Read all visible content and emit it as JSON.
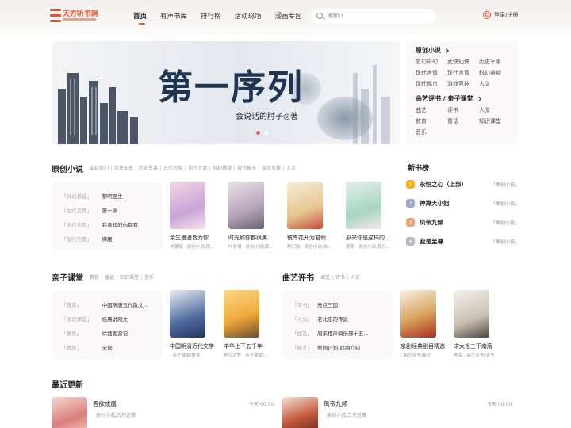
{
  "header": {
    "logo_text": "天方听书网",
    "nav": [
      "首页",
      "有声书库",
      "排行榜",
      "活动现场",
      "漫画专区"
    ],
    "search_placeholder": "搜索们",
    "login": "登录/注册"
  },
  "banner": {
    "title": "第一序列",
    "author": "会说话的肘子◎著"
  },
  "side_categories": [
    {
      "title": "原创小说",
      "items": [
        "玄幻奇幻",
        "武侠仙侠",
        "历史军事",
        "现代言情",
        "现代言情",
        "科幻悬疑",
        "现代都市",
        "游戏竞技",
        "人文"
      ]
    },
    {
      "title": "曲艺评书 / 亲子课堂",
      "items": [
        "曲艺",
        "评书",
        "人文",
        "教育",
        "童话",
        "知识课堂",
        "音乐"
      ]
    }
  ],
  "original": {
    "title": "原创小说",
    "tags": [
      "玄幻奇幻",
      "武侠仙侠",
      "历史军事",
      "古代言情",
      "现代言情",
      "科幻悬疑",
      "现代都市",
      "游戏竞技",
      "人文"
    ],
    "list": [
      {
        "tag": "「科幻悬疑」",
        "name": "黎明医生"
      },
      {
        "tag": "「古代言情」",
        "name": "第一侯"
      },
      {
        "tag": "「现代言情」",
        "name": "我喜欢的你都有"
      },
      {
        "tag": "「现代言情」",
        "name": "撑腰"
      }
    ],
    "books": [
      {
        "name": "余生漫漫皆为你",
        "meta": "洋蓬鹄 · 原创小说/现..."
      },
      {
        "name": "时光和你都很美",
        "meta": "叶非凝 · 原创小说/现..."
      },
      {
        "name": "彼岸花开为君倾",
        "meta": "穆闩筱 · 原创小说/古..."
      },
      {
        "name": "原来你是这样的...",
        "meta": "黛菁 · 原创小说/现代..."
      }
    ]
  },
  "new_rank": {
    "title": "新书榜",
    "items": [
      {
        "rank": "1",
        "name": "永恒之心（上部）",
        "cat": "「原创小说」"
      },
      {
        "rank": "2",
        "name": "神算大小姐",
        "cat": "「原创小说」"
      },
      {
        "rank": "3",
        "name": "凤帝九倾",
        "cat": "「原创小说」"
      },
      {
        "rank": "4",
        "name": "我是至尊",
        "cat": "「原创小说」"
      }
    ]
  },
  "parent": {
    "title": "亲子课堂",
    "tags": [
      "教育",
      "童话",
      "知识课堂",
      "音乐"
    ],
    "list": [
      {
        "tag": "「教育」",
        "name": "中国隋唐五代散文..."
      },
      {
        "tag": "「知识课堂」",
        "name": "杨晨说网文"
      },
      {
        "tag": "「教育」",
        "name": "徐茜客游记"
      },
      {
        "tag": "「教育」",
        "name": "宋词"
      }
    ],
    "books": [
      {
        "name": "中国明清近代文学",
        "meta": "· 亲子课堂/教育"
      },
      {
        "name": "中华上下五千年",
        "meta": "林汉达等 · 亲子课堂/..."
      }
    ]
  },
  "quyi": {
    "title": "曲艺评书",
    "tags": [
      "曲艺",
      "评书",
      "人文"
    ],
    "list": [
      {
        "tag": "「评书」",
        "name": "亮点三国"
      },
      {
        "tag": "「人文」",
        "name": "老北京的传说"
      },
      {
        "tag": "「曲艺」",
        "name": "周末相声俱乐部十五..."
      },
      {
        "tag": "「曲艺」",
        "name": "梨园计划-戏曲介绍"
      }
    ],
    "books": [
      {
        "name": "京剧经典剧目精选",
        "meta": "· 曲艺评书/曲艺"
      },
      {
        "name": "宋太祖三下南唐",
        "meta": "佚名 · 曲艺评书/评书"
      }
    ]
  },
  "recent": {
    "title": "最近更新",
    "items": [
      {
        "name": "吾欲成凰",
        "meta": "原创小说/古代言情",
        "time": "今天 00:00"
      },
      {
        "name": "凤帝九倾",
        "meta": "原创小说/古代言情",
        "time": "今天 00:00"
      }
    ]
  },
  "colors": {
    "accent": "#e8532b",
    "panel": "#faf8f8"
  }
}
